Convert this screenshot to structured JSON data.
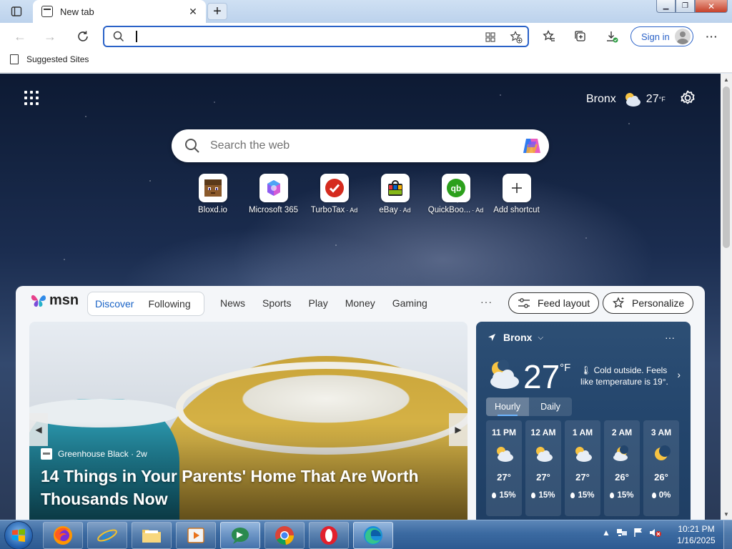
{
  "browser": {
    "tab_title": "New tab",
    "address_placeholder": "",
    "signin_label": "Sign in",
    "favorites": [
      {
        "label": "Suggested Sites"
      }
    ]
  },
  "ntp": {
    "weather_city": "Bronx",
    "weather_temp": "27",
    "weather_unit": "°F",
    "search_placeholder": "Search the web",
    "tiles": [
      {
        "label": "Bloxd.io",
        "ad": ""
      },
      {
        "label": "Microsoft 365",
        "ad": ""
      },
      {
        "label": "TurboTax",
        "ad": "· Ad"
      },
      {
        "label": "eBay",
        "ad": "· Ad"
      },
      {
        "label": "QuickBoo...",
        "ad": "· Ad"
      },
      {
        "label": "Add shortcut",
        "ad": ""
      }
    ]
  },
  "feed": {
    "brand": "msn",
    "tabs": [
      "Discover",
      "Following"
    ],
    "nav": [
      "News",
      "Sports",
      "Play",
      "Money",
      "Gaming"
    ],
    "more": "···",
    "feed_layout_label": "Feed layout",
    "personalize_label": "Personalize",
    "hero": {
      "source": "Greenhouse Black",
      "age": "· 2w",
      "title": "14 Things in Your Parents' Home That Are Worth Thousands Now"
    },
    "weather": {
      "location": "Bronx",
      "temp": "27",
      "unit": "°F",
      "description": "Cold outside. Feels like temperature is 19°.",
      "tabs": [
        "Hourly",
        "Daily"
      ],
      "hourly": [
        {
          "hour": "11 PM",
          "temp": "27°",
          "precip": "15%",
          "icon": "partly-cloudy-night-icon"
        },
        {
          "hour": "12 AM",
          "temp": "27°",
          "precip": "15%",
          "icon": "partly-cloudy-night-icon"
        },
        {
          "hour": "1 AM",
          "temp": "27°",
          "precip": "15%",
          "icon": "partly-cloudy-night-icon"
        },
        {
          "hour": "2 AM",
          "temp": "26°",
          "precip": "15%",
          "icon": "mostly-cloudy-night-icon"
        },
        {
          "hour": "3 AM",
          "temp": "26°",
          "precip": "0%",
          "icon": "clear-night-icon"
        }
      ]
    }
  },
  "taskbar": {
    "time": "10:21 PM",
    "date": "1/16/2025",
    "apps": [
      "firefox",
      "internet-explorer",
      "file-explorer",
      "media-player",
      "skype",
      "chrome",
      "opera",
      "edge"
    ]
  },
  "colors": {
    "accent": "#1a63c6",
    "address_border": "#2a62c8",
    "weather_card": "#23456c",
    "taskbar": "#3b6aa1"
  }
}
